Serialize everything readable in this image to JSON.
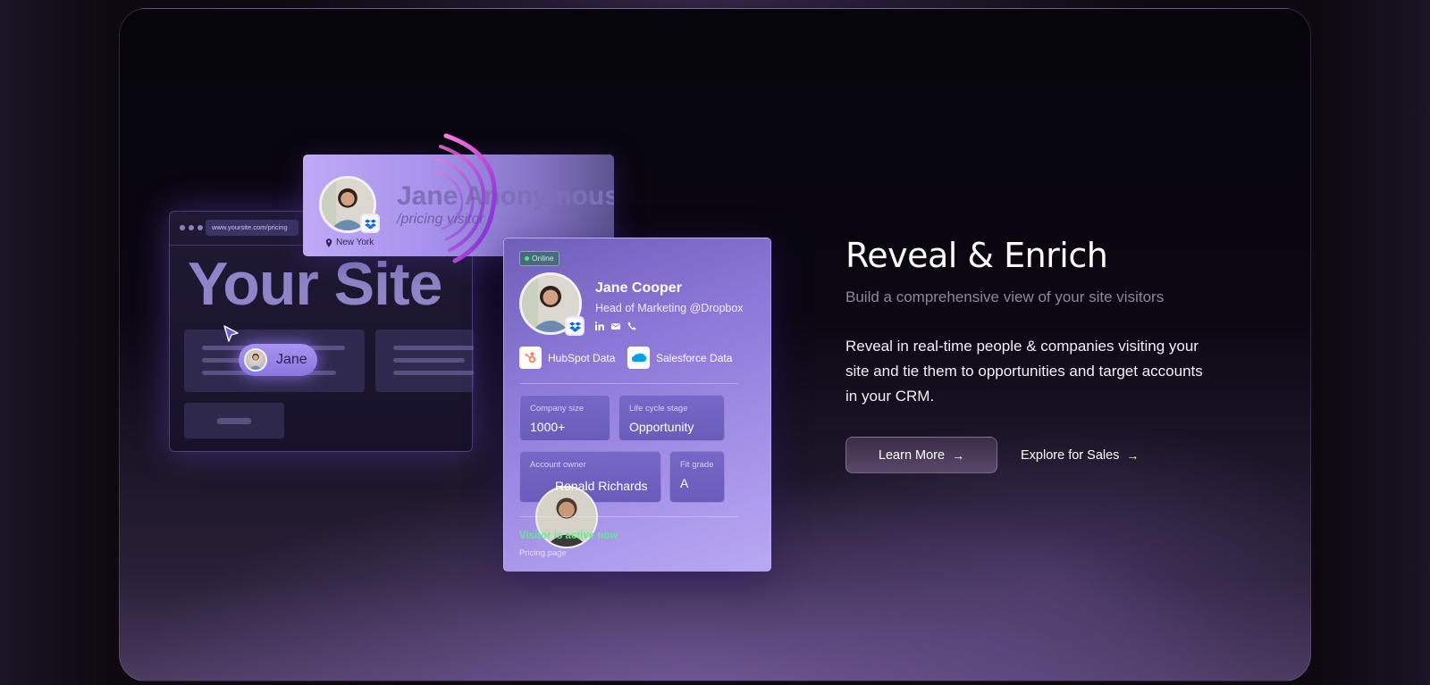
{
  "browser": {
    "url": "www.yoursite.com/pricing",
    "site_title": "Your Site",
    "chip_name": "Jane"
  },
  "anon_card": {
    "name": "Jane Anonymous",
    "path": "/pricing visitor",
    "location": "New York"
  },
  "profile_card": {
    "status": "Online",
    "name": "Jane Cooper",
    "role": "Head of Marketing @Dropbox",
    "integrations": [
      {
        "label": "HubSpot Data",
        "icon": "hubspot-icon"
      },
      {
        "label": "Salesforce Data",
        "icon": "salesforce-icon"
      }
    ],
    "fields": {
      "company_size": {
        "label": "Company size",
        "value": "1000+"
      },
      "lifecycle": {
        "label": "Life cycle stage",
        "value": "Opportunity"
      },
      "owner": {
        "label": "Account owner",
        "value": "Ronald Richards"
      },
      "fit": {
        "label": "Fit grade",
        "value": "A"
      }
    },
    "activity": "Visitor is active now",
    "page": "Pricing page"
  },
  "hero": {
    "headline": "Reveal & Enrich",
    "subhead": "Build a comprehensive view of your site visitors",
    "body": "Reveal in real-time people & companies visiting your site and tie them to opportunities and target accounts in your CRM.",
    "primary_cta": "Learn More",
    "secondary_cta": "Explore for Sales"
  },
  "colors": {
    "accent": "#a892ee",
    "online": "#3dea8e",
    "hubspot": "#ff7a59",
    "salesforce": "#00a1e0"
  }
}
